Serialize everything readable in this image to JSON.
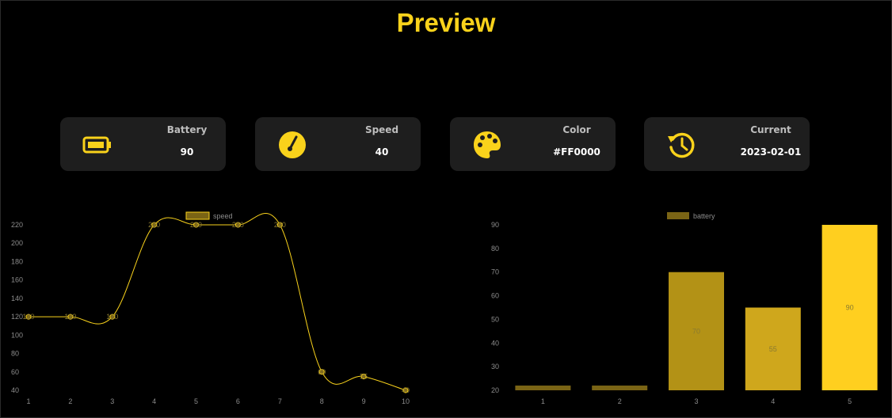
{
  "page": {
    "title": "Preview"
  },
  "cards": [
    {
      "label": "Battery",
      "value": "90",
      "icon": "battery-icon"
    },
    {
      "label": "Speed",
      "value": "40",
      "icon": "speedometer-icon"
    },
    {
      "label": "Color",
      "value": "#FF0000",
      "icon": "palette-icon"
    },
    {
      "label": "Current",
      "value": "2023-02-01",
      "icon": "history-icon"
    }
  ],
  "colors": {
    "accent": "#f9d21b",
    "card": "#1e1e1e",
    "background": "#000000"
  },
  "chart_data": [
    {
      "type": "line",
      "x": [
        1,
        2,
        3,
        4,
        5,
        6,
        7,
        8,
        9,
        10
      ],
      "series": [
        {
          "name": "speed",
          "values": [
            120,
            120,
            120,
            220,
            220,
            220,
            220,
            60,
            55,
            40
          ]
        }
      ],
      "data_labels": [
        "120",
        "120",
        "120",
        "220",
        "220",
        "220",
        "220",
        "60",
        "55",
        "40"
      ],
      "yticks": [
        40,
        60,
        80,
        100,
        120,
        140,
        160,
        180,
        200,
        220
      ],
      "ylim": [
        40,
        220
      ],
      "grid": false,
      "legend": "top-center"
    },
    {
      "type": "bar",
      "categories": [
        "1",
        "2",
        "3",
        "4",
        "5"
      ],
      "series": [
        {
          "name": "battery",
          "values": [
            22,
            22,
            70,
            55,
            90
          ]
        }
      ],
      "data_labels": [
        "",
        "",
        "70",
        "55",
        "90"
      ],
      "yticks": [
        20,
        30,
        40,
        50,
        60,
        70,
        80,
        90
      ],
      "ylim": [
        20,
        90
      ],
      "grid": false,
      "legend": "top-center",
      "bar_colors": [
        "#7a6415",
        "#7a6415",
        "#b39216",
        "#cfa71c",
        "#ffcf1f"
      ]
    }
  ]
}
